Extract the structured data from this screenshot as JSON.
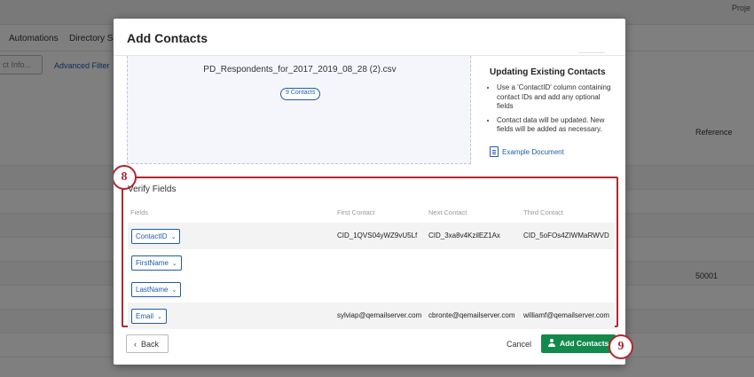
{
  "background": {
    "top_right": "Proje",
    "tabs": [
      "Automations",
      "Directory Set"
    ],
    "contact_info_button": "ct Info...",
    "advanced_filter": "Advanced Filter",
    "column_header": "Reference",
    "cell_value": "50001"
  },
  "modal": {
    "title": "Add Contacts",
    "file": {
      "name": "PD_Respondents_for_2017_2019_08_28 (2).csv",
      "count_badge": "9 Contacts"
    },
    "info": {
      "title": "Updating Existing Contacts",
      "bullets": [
        "Use a 'ContactID' column containing contact IDs and add any optional fields",
        "Contact data will be updated. New fields will be added as necessary."
      ],
      "example_link": "Example Document"
    },
    "verify": {
      "step_number": "8",
      "title": "Verify Fields",
      "headers": [
        "Fields",
        "First Contact",
        "Next Contact",
        "Third Contact"
      ],
      "rows": [
        {
          "field": "ContactID",
          "first": "CID_1QVS04yWZ9vU5Lf",
          "next": "CID_3xa8v4KzilEZ1Ax",
          "third": "CID_5oFOs4ZIWMaRWVD"
        },
        {
          "field": "FirstName",
          "first": "",
          "next": "",
          "third": ""
        },
        {
          "field": "LastName",
          "first": "",
          "next": "",
          "third": ""
        },
        {
          "field": "Email",
          "first": "sylviap@qemailserver.com",
          "next": "cbronte@qemailserver.com",
          "third": "williamf@qemailserver.com"
        }
      ]
    },
    "footer": {
      "back_label": "Back",
      "cancel_label": "Cancel",
      "add_label": "Add Contacts",
      "step_number": "9"
    }
  },
  "colors": {
    "accent": "#1f5ca8",
    "primary_button": "#13894b",
    "callout": "#b0282f"
  }
}
